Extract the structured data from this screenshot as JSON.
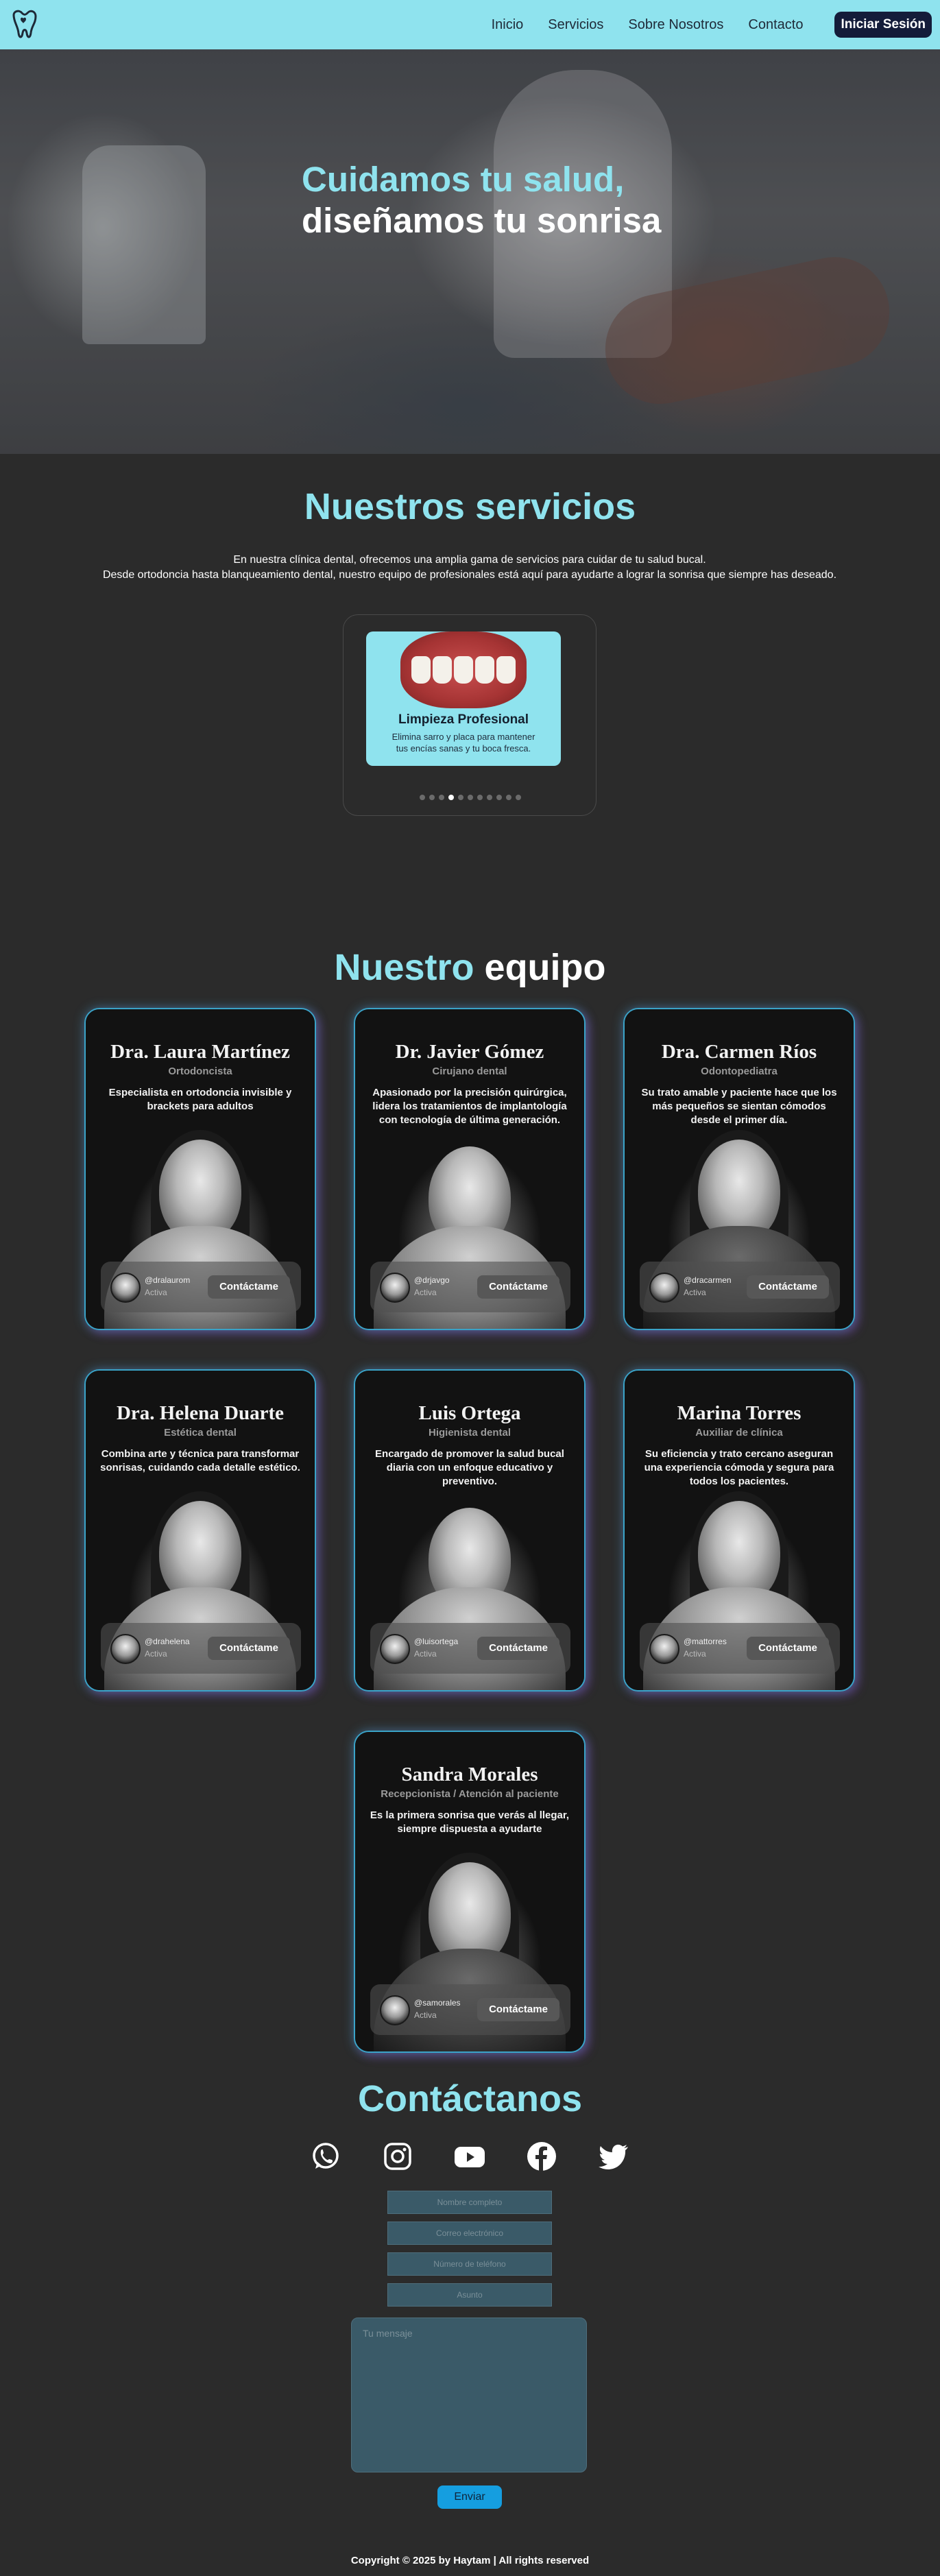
{
  "nav": {
    "links": [
      "Inicio",
      "Servicios",
      "Sobre Nosotros",
      "Contacto"
    ],
    "login_label": "Iniciar Sesión",
    "logo_icon": "tooth-heart-icon",
    "background": "#8fe3ee"
  },
  "hero": {
    "title_accent": "Cuidamos tu salud,",
    "title_rest": "diseñamos tu sonrisa"
  },
  "services": {
    "title": "Nuestros servicios",
    "description_line1": "En nuestra clínica dental, ofrecemos una amplia gama de servicios para cuidar de tu salud bucal.",
    "description_line2": "Desde ortodoncia hasta blanqueamiento dental, nuestro equipo de profesionales está aquí para ayudarte a lograr la sonrisa que siempre has deseado.",
    "current": {
      "name": "Limpieza Profesional",
      "description": "Elimina sarro y placa para mantener tus encías sanas y tu boca fresca."
    },
    "dots_total": 11,
    "dots_active_index": 3
  },
  "team": {
    "title_accent": "Nuestro",
    "title_rest": "equipo",
    "members": [
      {
        "name": "Dra. Laura Martínez",
        "role": "Ortodoncista",
        "desc": "Especialista en ortodoncia invisible y brackets para adultos",
        "handle": "@dralaurom",
        "status": "Activa",
        "button": "Contáctame"
      },
      {
        "name": "Dr. Javier Gómez",
        "role": "Cirujano dental",
        "desc": "Apasionado por la precisión quirúrgica, lidera los tratamientos de implantología con tecnología de última generación.",
        "handle": "@drjavgo",
        "status": "Activa",
        "button": "Contáctame"
      },
      {
        "name": "Dra. Carmen Ríos",
        "role": "Odontopediatra",
        "desc": "Su trato amable y paciente hace que los más pequeños se sientan cómodos desde el primer día.",
        "handle": "@dracarmen",
        "status": "Activa",
        "button": "Contáctame"
      },
      {
        "name": "Dra. Helena Duarte",
        "role": "Estética dental",
        "desc": "Combina arte y técnica para transformar sonrisas, cuidando cada detalle estético.",
        "handle": "@drahelena",
        "status": "Activa",
        "button": "Contáctame"
      },
      {
        "name": "Luis Ortega",
        "role": "Higienista dental",
        "desc": "Encargado de promover la salud bucal diaria con un enfoque educativo y preventivo.",
        "handle": "@luisortega",
        "status": "Activa",
        "button": "Contáctame"
      },
      {
        "name": "Marina Torres",
        "role": "Auxiliar de clínica",
        "desc": "Su eficiencia y trato cercano aseguran una experiencia cómoda y segura para todos los pacientes.",
        "handle": "@mattorres",
        "status": "Activa",
        "button": "Contáctame"
      },
      {
        "name": "Sandra Morales",
        "role": "Recepcionista / Atención al paciente",
        "desc": "Es la primera sonrisa que verás al llegar, siempre dispuesta a ayudarte",
        "handle": "@samorales",
        "status": "Activa",
        "button": "Contáctame"
      }
    ]
  },
  "contact": {
    "title": "Contáctanos",
    "social_icons": [
      "whatsapp-icon",
      "instagram-icon",
      "youtube-icon",
      "facebook-icon",
      "twitter-icon"
    ],
    "placeholders": {
      "name": "Nombre completo",
      "email": "Correo electrónico",
      "phone": "Número de teléfono",
      "subject": "Asunto",
      "message": "Tu mensaje"
    },
    "send_label": "Enviar"
  },
  "footer": {
    "text": "Copyright © 2025 by Haytam | All rights reserved"
  },
  "colors": {
    "accent": "#8fe3ee",
    "background": "#2b2b2b",
    "send_button": "#159ee0",
    "card_border": "#3aa3c8"
  }
}
